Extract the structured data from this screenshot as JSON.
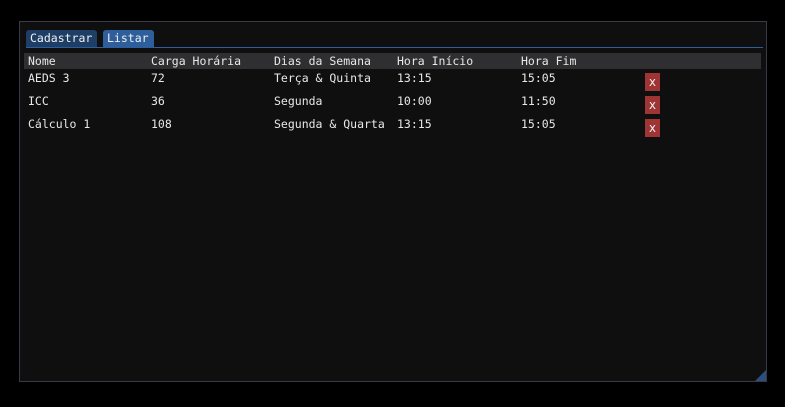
{
  "tabs": [
    {
      "label": "Cadastrar",
      "active": false
    },
    {
      "label": "Listar",
      "active": true
    }
  ],
  "table": {
    "columns": [
      "Nome",
      "Carga Horária",
      "Dias da Semana",
      "Hora Início",
      "Hora Fim"
    ],
    "rows": [
      {
        "nome": "AEDS 3",
        "carga": "72",
        "dias": "Terça & Quinta",
        "inicio": "13:15",
        "fim": "15:05"
      },
      {
        "nome": "ICC",
        "carga": "36",
        "dias": "Segunda",
        "inicio": "10:00",
        "fim": "11:50"
      },
      {
        "nome": "Cálculo 1",
        "carga": "108",
        "dias": "Segunda & Quarta",
        "inicio": "13:15",
        "fim": "15:05"
      }
    ],
    "delete_label": "x"
  },
  "colors": {
    "window_bg": "#0f0f0f",
    "tab_active": "#2e5f9c",
    "tab_inactive": "#1e3e66",
    "header_bg": "#2f2f31",
    "delete_button": "#9e3434"
  }
}
